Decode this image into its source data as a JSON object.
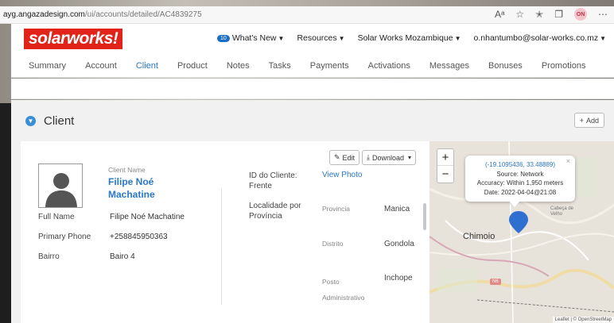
{
  "browser": {
    "url_host": "ayg.angazadesign.com",
    "url_path": "/ui/accounts/detailed/AC4839275",
    "profile_initials": "ON"
  },
  "header": {
    "logo_text": "solarworks!",
    "whats_new_count": "10",
    "whats_new_label": "What's New",
    "resources_label": "Resources",
    "org_label": "Solar Works Mozambique",
    "user_email": "o.nhantumbo@solar-works.co.mz"
  },
  "tabs": [
    {
      "label": "Summary"
    },
    {
      "label": "Account"
    },
    {
      "label": "Client"
    },
    {
      "label": "Product"
    },
    {
      "label": "Notes"
    },
    {
      "label": "Tasks"
    },
    {
      "label": "Payments"
    },
    {
      "label": "Activations"
    },
    {
      "label": "Messages"
    },
    {
      "label": "Bonuses"
    },
    {
      "label": "Promotions"
    }
  ],
  "active_tab": "Client",
  "section": {
    "title": "Client",
    "add_label": "Add"
  },
  "client": {
    "name_label": "Client Name",
    "name": "Filipe Noé Machatine",
    "fields": [
      {
        "label": "Full Name",
        "value": "Filipe Noé Machatine"
      },
      {
        "label": "Primary Phone",
        "value": "+258845950363"
      },
      {
        "label": "Bairro",
        "value": "Bairo 4"
      }
    ],
    "edit_label": "Edit",
    "download_label": "Download",
    "id_label": "ID do Cliente: Frente",
    "id_link": "View Photo",
    "locality_label": "Localidade por Província",
    "locality": [
      {
        "label": "Provincia",
        "value": "Manica"
      },
      {
        "label": "Distrito",
        "value": "Gondola"
      },
      {
        "label": "Posto Administrativo",
        "value": "Inchope"
      }
    ]
  },
  "map": {
    "coords": "(-19.1095436, 33.48889)",
    "source": "Source: Network",
    "accuracy": "Accuracy: Within 1,950 meters",
    "date": "Date: 2022-04-04@21:08",
    "city": "Chimoio",
    "small_place": "Cabeça de Velho",
    "road_label": "N6",
    "attribution": "Leaflet | © OpenStreetMap"
  },
  "colors": {
    "accent": "#2a78c8",
    "brand_red": "#e2231a",
    "pin": "#2f6fd0"
  }
}
